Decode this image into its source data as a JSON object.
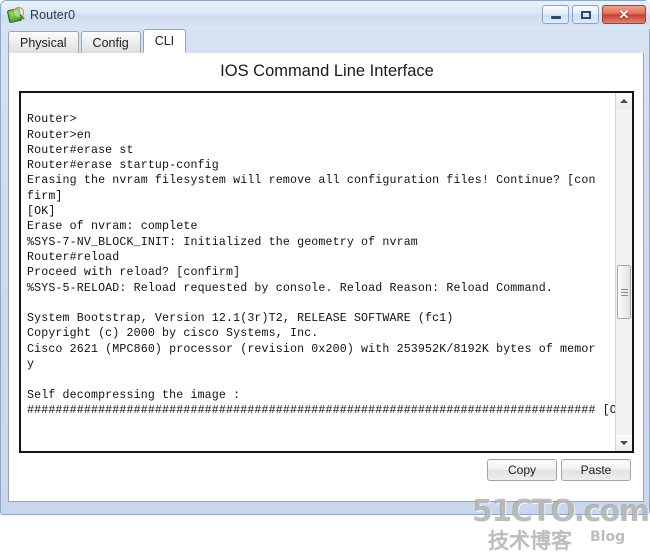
{
  "window": {
    "title": "Router0",
    "icon": "router-icon",
    "controls": {
      "minimize": "–",
      "maximize": "□",
      "close": "✕"
    }
  },
  "tabs": [
    {
      "label": "Physical",
      "active": false
    },
    {
      "label": "Config",
      "active": false
    },
    {
      "label": "CLI",
      "active": true
    }
  ],
  "panel": {
    "title": "IOS Command Line Interface"
  },
  "terminal": {
    "lines": [
      "",
      "Router>",
      "Router>en",
      "Router#erase st",
      "Router#erase startup-config",
      "Erasing the nvram filesystem will remove all configuration files! Continue? [con",
      "firm]",
      "[OK]",
      "Erase of nvram: complete",
      "%SYS-7-NV_BLOCK_INIT: Initialized the geometry of nvram",
      "Router#reload",
      "Proceed with reload? [confirm]",
      "%SYS-5-RELOAD: Reload requested by console. Reload Reason: Reload Command.",
      "",
      "System Bootstrap, Version 12.1(3r)T2, RELEASE SOFTWARE (fc1)",
      "Copyright (c) 2000 by cisco Systems, Inc.",
      "Cisco 2621 (MPC860) processor (revision 0x200) with 253952K/8192K bytes of memor",
      "y",
      "",
      "Self decompressing the image :",
      "################################################################################ [OK]"
    ]
  },
  "scrollbar": {
    "up_arrow": "scroll-up-arrow",
    "down_arrow": "scroll-down-arrow"
  },
  "buttons": {
    "copy": "Copy",
    "paste": "Paste"
  },
  "watermark": {
    "main": "51CTO.com",
    "sub": "技术博客",
    "blog": "Blog"
  },
  "colors": {
    "window_frame": "#c9d7ec",
    "accent_close": "#c8412c",
    "terminal_bg": "#ffffff",
    "terminal_fg": "#111111"
  }
}
